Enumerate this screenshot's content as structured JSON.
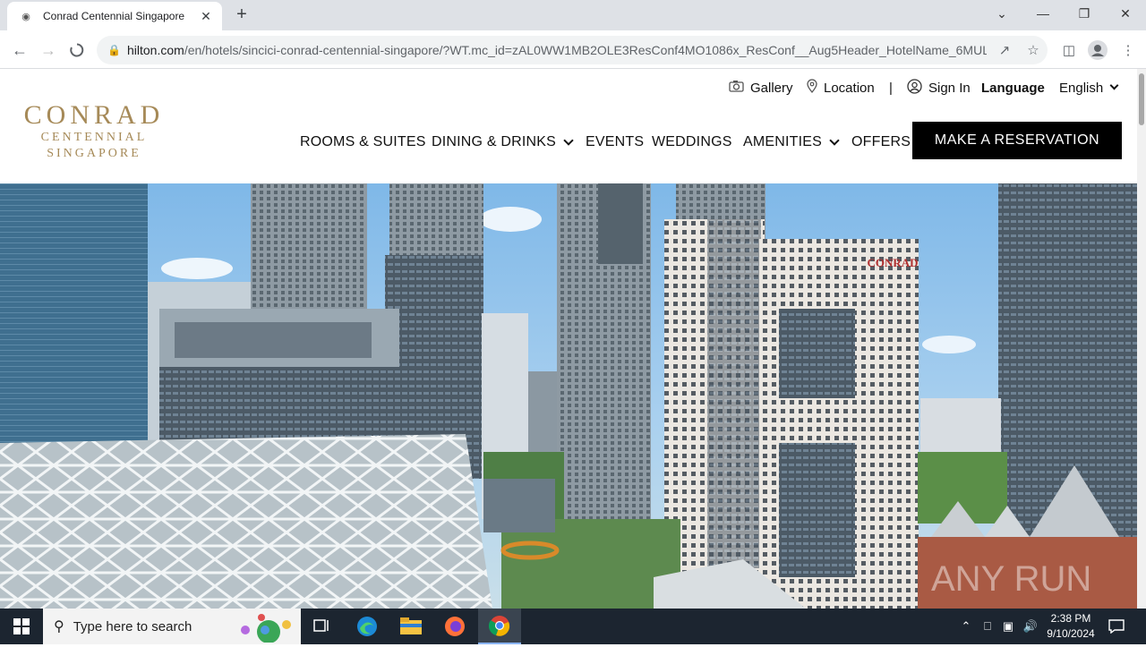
{
  "browser": {
    "tab_title": "Conrad Centennial Singapore",
    "url_host": "hilton.com",
    "url_rest": "/en/hotels/sincici-conrad-centennial-singapore/?WT.mc_id=zAL0WW1MB2OLE3ResConf4MO1086x_ResConf__Aug5Header_HotelName_6MULTI..."
  },
  "site": {
    "logo_brand": "CONRAD",
    "logo_line1": "CENTENNIAL",
    "logo_line2": "SINGAPORE",
    "utility": {
      "gallery": "Gallery",
      "location": "Location",
      "separator": "|",
      "sign_in": "Sign In",
      "language_label": "Language",
      "language_value": "English"
    },
    "nav": {
      "rooms": "ROOMS & SUITES",
      "dining": "DINING & DRINKS",
      "events": "EVENTS",
      "weddings": "WEDDINGS",
      "amenities": "AMENITIES",
      "offers": "OFFERS"
    },
    "reserve_button": "MAKE A RESERVATION",
    "hero_sign": "CONRAD",
    "watermark": "ANY RUN"
  },
  "taskbar": {
    "search_placeholder": "Type here to search",
    "time": "2:38 PM",
    "date": "9/10/2024"
  }
}
